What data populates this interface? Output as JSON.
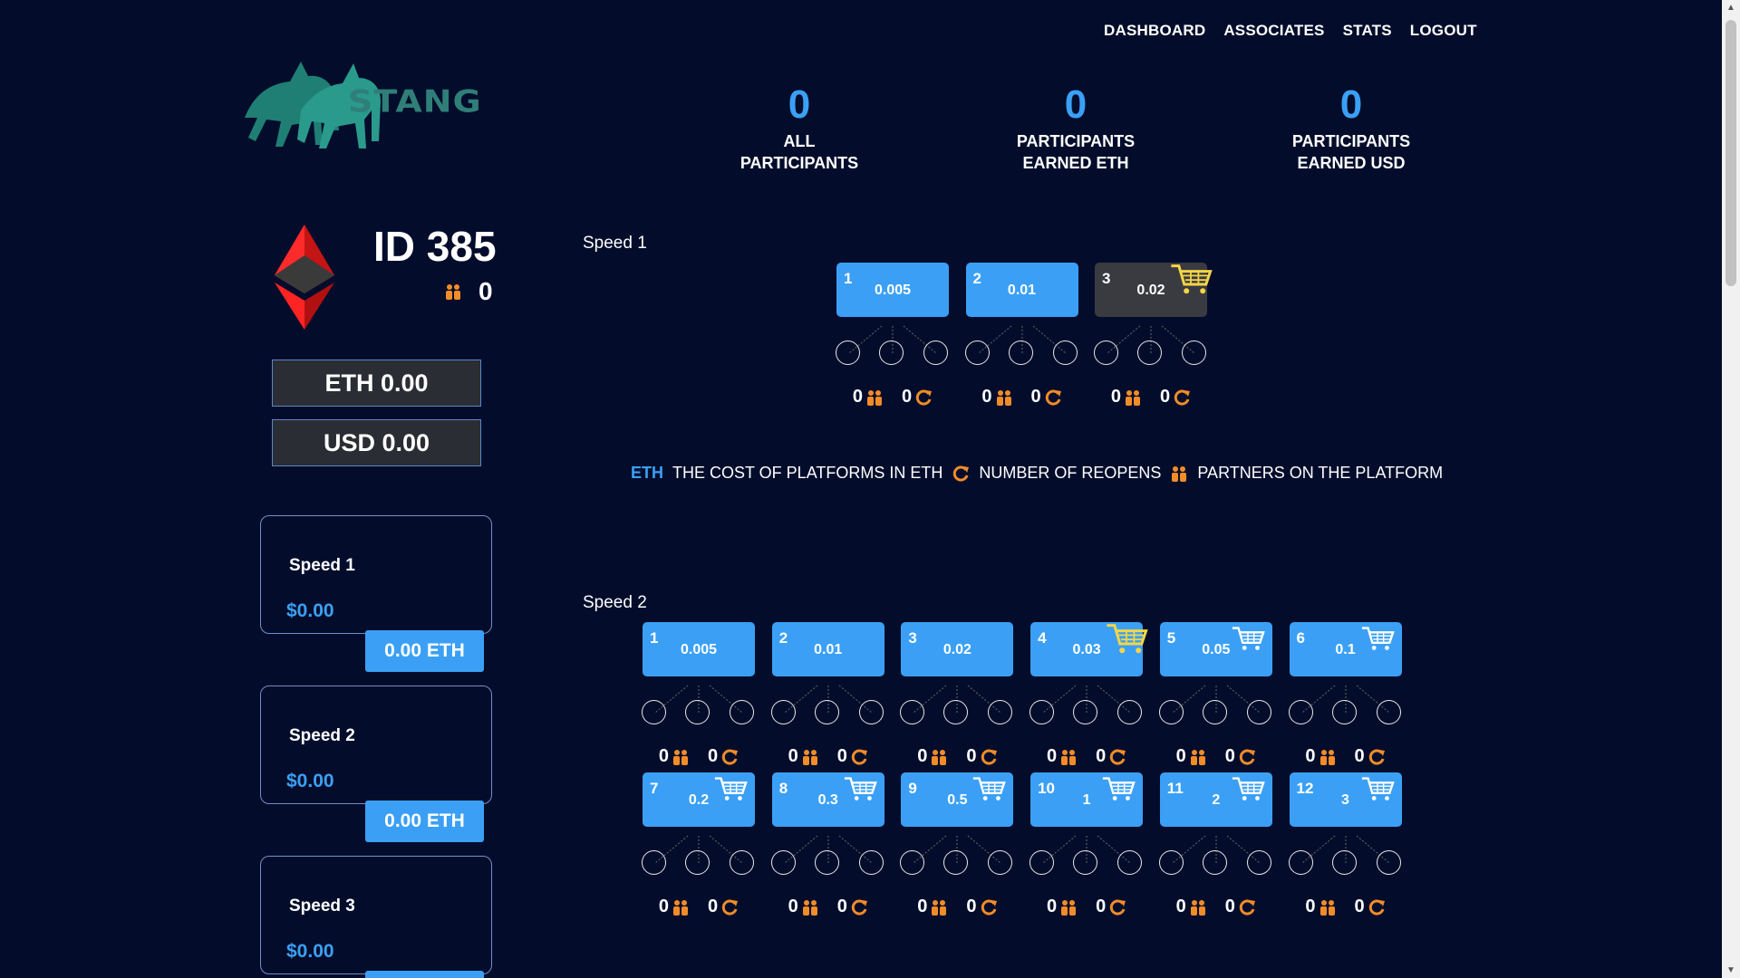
{
  "nav": {
    "dashboard": "DASHBOARD",
    "associates": "ASSOCIATES",
    "stats": "STATS",
    "logout": "LOGOUT"
  },
  "logo": {
    "text": "STANG"
  },
  "stats": [
    {
      "value": "0",
      "label_line1": "ALL",
      "label_line2": "PARTICIPANTS"
    },
    {
      "value": "0",
      "label_line1": "PARTICIPANTS",
      "label_line2": "EARNED ETH"
    },
    {
      "value": "0",
      "label_line1": "PARTICIPANTS",
      "label_line2": "EARNED USD"
    }
  ],
  "user": {
    "id": "ID 385",
    "partners": "0"
  },
  "balances": {
    "eth": "ETH 0.00",
    "usd": "USD 0.00"
  },
  "speed_cards": [
    {
      "title": "Speed 1",
      "usd": "$0.00",
      "eth": "0.00 ETH"
    },
    {
      "title": "Speed 2",
      "usd": "$0.00",
      "eth": "0.00 ETH"
    },
    {
      "title": "Speed 3",
      "usd": "$0.00",
      "eth": ""
    }
  ],
  "speed1": {
    "title": "Speed 1",
    "platforms": [
      {
        "num": "1",
        "cost": "0.005",
        "partners": "0",
        "reopens": "0",
        "state": "active",
        "cart": "none"
      },
      {
        "num": "2",
        "cost": "0.01",
        "partners": "0",
        "reopens": "0",
        "state": "active",
        "cart": "none"
      },
      {
        "num": "3",
        "cost": "0.02",
        "partners": "0",
        "reopens": "0",
        "state": "inactive",
        "cart": "yellow"
      }
    ]
  },
  "legend": {
    "eth": "ETH",
    "cost": "THE COST OF PLATFORMS IN ETH",
    "reopens": "NUMBER OF REOPENS",
    "partners": "PARTNERS ON THE PLATFORM"
  },
  "speed2": {
    "title": "Speed 2",
    "platforms": [
      {
        "num": "1",
        "cost": "0.005",
        "partners": "0",
        "reopens": "0",
        "cart": "none"
      },
      {
        "num": "2",
        "cost": "0.01",
        "partners": "0",
        "reopens": "0",
        "cart": "none"
      },
      {
        "num": "3",
        "cost": "0.02",
        "partners": "0",
        "reopens": "0",
        "cart": "none"
      },
      {
        "num": "4",
        "cost": "0.03",
        "partners": "0",
        "reopens": "0",
        "cart": "yellow"
      },
      {
        "num": "5",
        "cost": "0.05",
        "partners": "0",
        "reopens": "0",
        "cart": "white"
      },
      {
        "num": "6",
        "cost": "0.1",
        "partners": "0",
        "reopens": "0",
        "cart": "white"
      },
      {
        "num": "7",
        "cost": "0.2",
        "partners": "0",
        "reopens": "0",
        "cart": "white"
      },
      {
        "num": "8",
        "cost": "0.3",
        "partners": "0",
        "reopens": "0",
        "cart": "white"
      },
      {
        "num": "9",
        "cost": "0.5",
        "partners": "0",
        "reopens": "0",
        "cart": "white"
      },
      {
        "num": "10",
        "cost": "1",
        "partners": "0",
        "reopens": "0",
        "cart": "white"
      },
      {
        "num": "11",
        "cost": "2",
        "partners": "0",
        "reopens": "0",
        "cart": "white"
      },
      {
        "num": "12",
        "cost": "3",
        "partners": "0",
        "reopens": "0",
        "cart": "white"
      }
    ]
  },
  "colors": {
    "background": "#030d2b",
    "accent": "#3ba0f5",
    "orange": "#f28c28",
    "card_border": "#6f8fc9",
    "inactive": "#3a3b40",
    "cart_yellow": "#f5d547"
  }
}
